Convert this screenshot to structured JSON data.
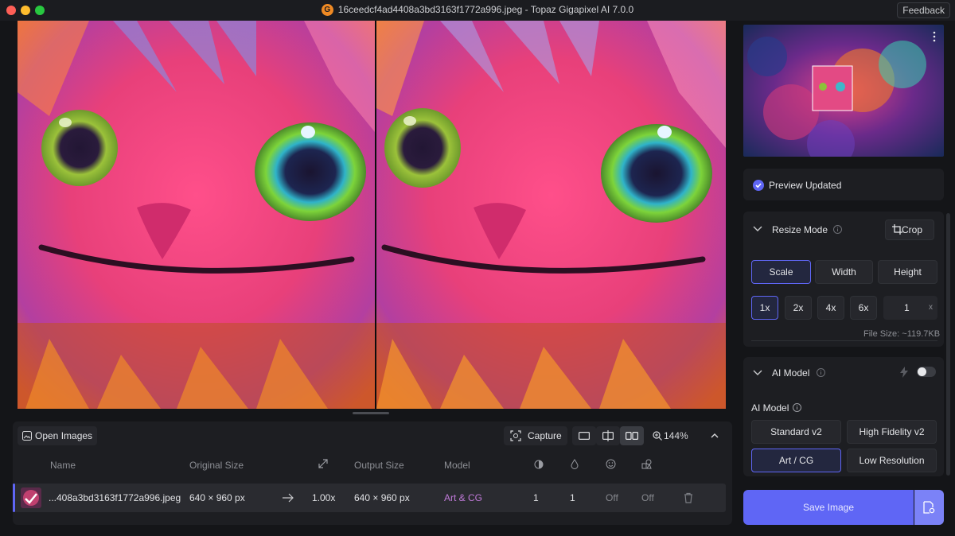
{
  "window": {
    "title": "16ceedcf4ad4408a3bd3163f1772a996.jpeg - Topaz Gigapixel AI 7.0.0",
    "logo_letter": "G",
    "feedback_label": "Feedback"
  },
  "toolbar": {
    "open_label": "Open Images",
    "capture_label": "Capture",
    "zoom_level": "144%"
  },
  "table": {
    "headers": {
      "name": "Name",
      "original": "Original Size",
      "output": "Output Size",
      "model": "Model"
    },
    "row": {
      "name": "...408a3bd3163f1772a996.jpeg",
      "original_size": "640 × 960 px",
      "scale": "1.00x",
      "output_size": "640 × 960 px",
      "model": "Art & CG",
      "denoise": "1",
      "sharpen": "1",
      "face": "Off",
      "tone": "Off"
    }
  },
  "preview": {
    "status": "Preview Updated"
  },
  "resize": {
    "title": "Resize Mode",
    "crop_label": "Crop",
    "modes": [
      "Scale",
      "Width",
      "Height"
    ],
    "active_mode": "Scale",
    "scales": [
      "1x",
      "2x",
      "4x",
      "6x"
    ],
    "active_scale": "1x",
    "custom_scale": "1",
    "custom_suffix": "x",
    "file_size": "File Size: ~119.7KB"
  },
  "ai_model": {
    "title": "AI Model",
    "section_label": "AI Model",
    "models": [
      "Standard v2",
      "High Fidelity v2",
      "Art / CG",
      "Low Resolution"
    ],
    "active_model": "Art / CG",
    "enabled": false
  },
  "save": {
    "label": "Save Image"
  },
  "colors": {
    "accent": "#5f66f5",
    "panel": "#1d1e22",
    "background": "#141518",
    "model_text": "#c07ad9"
  }
}
